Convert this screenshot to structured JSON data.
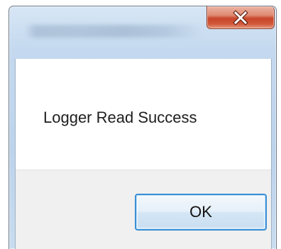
{
  "window": {
    "title": "",
    "close_icon": "close-icon",
    "accent_close": "#c8452a",
    "frame_color": "#bcd3ec"
  },
  "dialog": {
    "message": "Logger Read Success",
    "ok_label": "OK",
    "ok_border_color": "#3c8fd4"
  }
}
